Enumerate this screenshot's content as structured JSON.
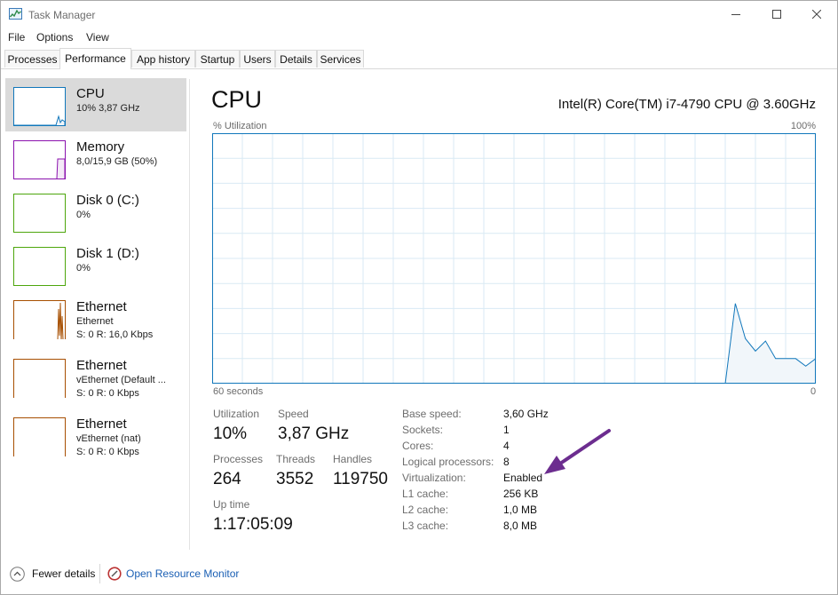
{
  "window": {
    "title": "Task Manager",
    "controls": [
      "minimize",
      "maximize",
      "close"
    ]
  },
  "menu": [
    "File",
    "Options",
    "View"
  ],
  "tabs": [
    {
      "label": "Processes",
      "active": false
    },
    {
      "label": "Performance",
      "active": true
    },
    {
      "label": "App history",
      "active": false
    },
    {
      "label": "Startup",
      "active": false
    },
    {
      "label": "Users",
      "active": false
    },
    {
      "label": "Details",
      "active": false
    },
    {
      "label": "Services",
      "active": false
    }
  ],
  "sidebar": [
    {
      "name": "CPU",
      "sub1": "10% 3,87 GHz",
      "sub2": "",
      "color": "#1177bb",
      "selected": true
    },
    {
      "name": "Memory",
      "sub1": "8,0/15,9 GB (50%)",
      "sub2": "",
      "color": "#8b12ae",
      "selected": false
    },
    {
      "name": "Disk 0 (C:)",
      "sub1": "0%",
      "sub2": "",
      "color": "#4da60c",
      "selected": false
    },
    {
      "name": "Disk 1 (D:)",
      "sub1": "0%",
      "sub2": "",
      "color": "#4da60c",
      "selected": false
    },
    {
      "name": "Ethernet",
      "sub1": "Ethernet",
      "sub2": "S: 0 R: 16,0 Kbps",
      "color": "#a74f01",
      "selected": false
    },
    {
      "name": "Ethernet",
      "sub1": "vEthernet (Default ...",
      "sub2": "S: 0 R: 0 Kbps",
      "color": "#a74f01",
      "selected": false
    },
    {
      "name": "Ethernet",
      "sub1": "vEthernet (nat)",
      "sub2": "S: 0 R: 0 Kbps",
      "color": "#a74f01",
      "selected": false
    }
  ],
  "main": {
    "title": "CPU",
    "model": "Intel(R) Core(TM) i7-4790 CPU @ 3.60GHz",
    "graph": {
      "ylabel": "% Utilization",
      "ymax_label": "100%",
      "xlabel_left": "60 seconds",
      "xlabel_right": "0",
      "line_color": "#1177bb",
      "fill_color": "#f1f6fa",
      "grid_color": "#d9eaf4",
      "utilization_percent": [
        0,
        0,
        0,
        0,
        0,
        0,
        0,
        0,
        0,
        0,
        0,
        0,
        0,
        0,
        0,
        0,
        0,
        0,
        0,
        0,
        0,
        0,
        0,
        0,
        0,
        0,
        0,
        0,
        0,
        0,
        0,
        0,
        0,
        0,
        0,
        0,
        0,
        0,
        0,
        0,
        0,
        0,
        0,
        0,
        0,
        0,
        0,
        0,
        0,
        0,
        0,
        0,
        32,
        18,
        13,
        17,
        10,
        10,
        10,
        7,
        10
      ]
    },
    "stats": {
      "utilization": {
        "label": "Utilization",
        "value": "10%"
      },
      "speed": {
        "label": "Speed",
        "value": "3,87 GHz"
      },
      "processes": {
        "label": "Processes",
        "value": "264"
      },
      "threads": {
        "label": "Threads",
        "value": "3552"
      },
      "handles": {
        "label": "Handles",
        "value": "119750"
      },
      "uptime": {
        "label": "Up time",
        "value": "1:17:05:09"
      }
    },
    "specs": [
      {
        "label": "Base speed:",
        "value": "3,60 GHz"
      },
      {
        "label": "Sockets:",
        "value": "1"
      },
      {
        "label": "Cores:",
        "value": "4"
      },
      {
        "label": "Logical processors:",
        "value": "8"
      },
      {
        "label": "Virtualization:",
        "value": "Enabled"
      },
      {
        "label": "L1 cache:",
        "value": "256 KB"
      },
      {
        "label": "L2 cache:",
        "value": "1,0 MB"
      },
      {
        "label": "L3 cache:",
        "value": "8,0 MB"
      }
    ],
    "annotation_arrow_color": "#6c2d8f"
  },
  "footer": {
    "fewer_details": "Fewer details",
    "resource_monitor": "Open Resource Monitor"
  }
}
